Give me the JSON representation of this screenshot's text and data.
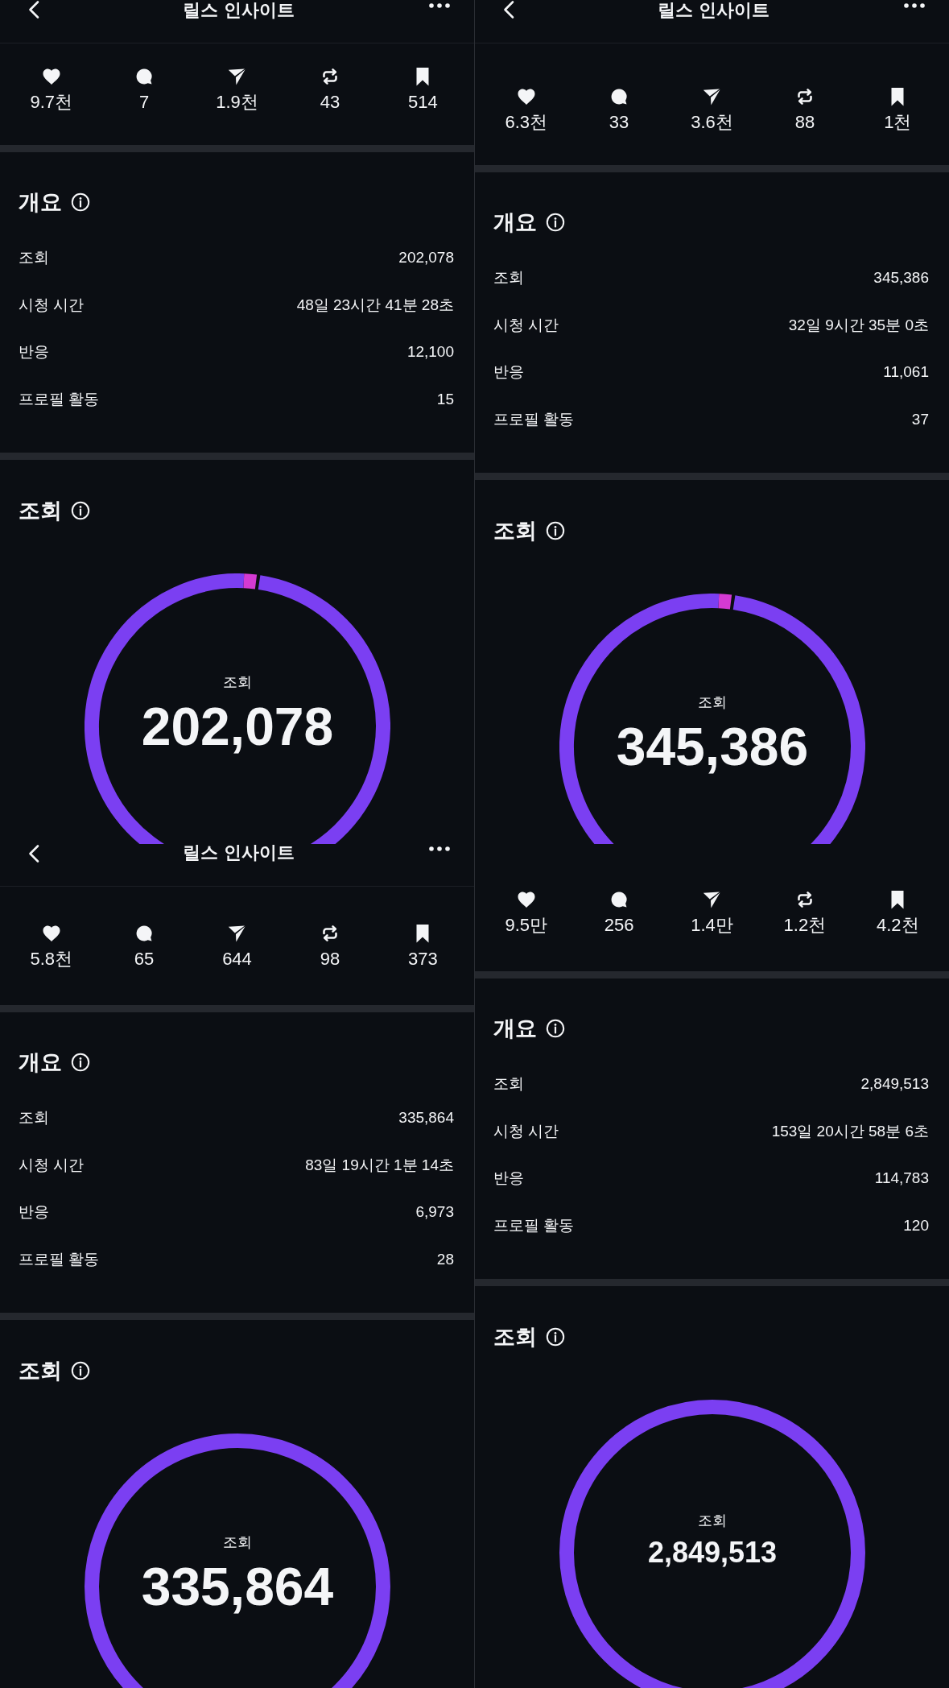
{
  "panels": [
    {
      "header": {
        "title": "릴스 인사이트"
      },
      "stats": [
        {
          "kind": "like",
          "value": "9.7천"
        },
        {
          "kind": "comment",
          "value": "7"
        },
        {
          "kind": "share",
          "value": "1.9천"
        },
        {
          "kind": "repost",
          "value": "43"
        },
        {
          "kind": "save",
          "value": "514"
        }
      ],
      "overview": {
        "title": "개요",
        "rows": [
          {
            "label": "조회",
            "value": "202,078"
          },
          {
            "label": "시청 시간",
            "value": "48일 23시간 41분 28초"
          },
          {
            "label": "반응",
            "value": "12,100"
          },
          {
            "label": "프로필 활동",
            "value": "15"
          }
        ]
      },
      "views": {
        "title": "조회",
        "ring": {
          "kind": "split",
          "label": "조회",
          "value": "202,078"
        }
      }
    },
    {
      "header": {
        "title": "릴스 인사이트"
      },
      "stats": [
        {
          "kind": "like",
          "value": "6.3천"
        },
        {
          "kind": "comment",
          "value": "33"
        },
        {
          "kind": "share",
          "value": "3.6천"
        },
        {
          "kind": "repost",
          "value": "88"
        },
        {
          "kind": "save",
          "value": "1천"
        }
      ],
      "overview": {
        "title": "개요",
        "rows": [
          {
            "label": "조회",
            "value": "345,386"
          },
          {
            "label": "시청 시간",
            "value": "32일 9시간 35분 0초"
          },
          {
            "label": "반응",
            "value": "11,061"
          },
          {
            "label": "프로필 활동",
            "value": "37"
          }
        ]
      },
      "views": {
        "title": "조회",
        "ring": {
          "kind": "split",
          "label": "조회",
          "value": "345,386"
        }
      }
    },
    {
      "header": {
        "title": "릴스 인사이트"
      },
      "stats": [
        {
          "kind": "like",
          "value": "5.8천"
        },
        {
          "kind": "comment",
          "value": "65"
        },
        {
          "kind": "share",
          "value": "644"
        },
        {
          "kind": "repost",
          "value": "98"
        },
        {
          "kind": "save",
          "value": "373"
        }
      ],
      "overview": {
        "title": "개요",
        "rows": [
          {
            "label": "조회",
            "value": "335,864"
          },
          {
            "label": "시청 시간",
            "value": "83일 19시간 1분 14초"
          },
          {
            "label": "반응",
            "value": "6,973"
          },
          {
            "label": "프로필 활동",
            "value": "28"
          }
        ]
      },
      "views": {
        "title": "조회",
        "ring": {
          "kind": "full",
          "label": "조회",
          "value": "335,864"
        }
      }
    },
    {
      "stats": [
        {
          "kind": "like",
          "value": "9.5만"
        },
        {
          "kind": "comment",
          "value": "256"
        },
        {
          "kind": "share",
          "value": "1.4만"
        },
        {
          "kind": "repost",
          "value": "1.2천"
        },
        {
          "kind": "save",
          "value": "4.2천"
        }
      ],
      "overview": {
        "title": "개요",
        "rows": [
          {
            "label": "조회",
            "value": "2,849,513"
          },
          {
            "label": "시청 시간",
            "value": "153일 20시간 58분 6초"
          },
          {
            "label": "반응",
            "value": "114,783"
          },
          {
            "label": "프로필 활동",
            "value": "120"
          }
        ]
      },
      "views": {
        "title": "조회",
        "ring": {
          "kind": "full",
          "label": "조회",
          "value": "2,849,513"
        }
      }
    }
  ]
}
